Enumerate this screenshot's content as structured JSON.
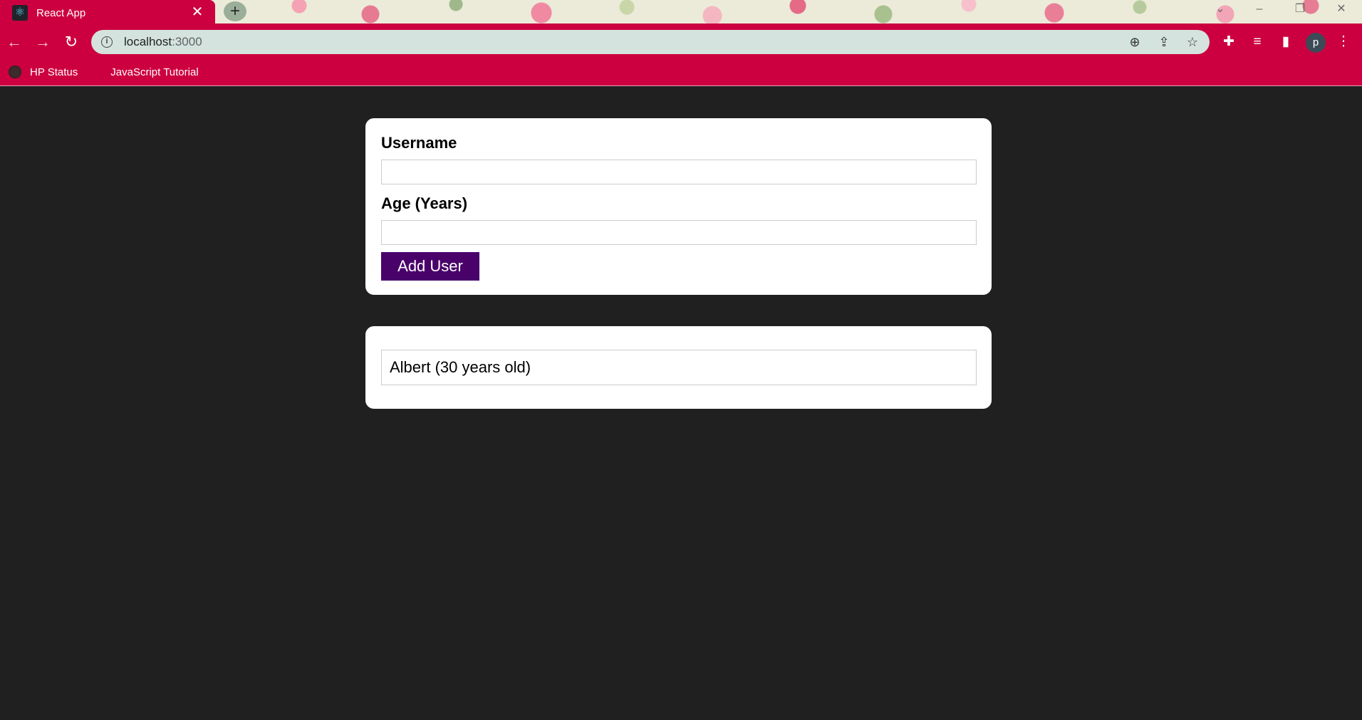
{
  "browser": {
    "tab_title": "React App",
    "tab_close": "✕",
    "new_tab": "+",
    "url_host": "localhost",
    "url_port": ":3000",
    "bookmarks": [
      {
        "label": "HP Status"
      },
      {
        "label": "JavaScript Tutorial"
      }
    ],
    "profile_initial": "p",
    "theme_color": "#cc0040",
    "omnibox_color": "#d4e3dd"
  },
  "form": {
    "username_label": "Username",
    "username_value": "",
    "age_label": "Age (Years)",
    "age_value": "",
    "submit_label": "Add User",
    "button_color": "#4a026b"
  },
  "users": [
    {
      "text": "Albert (30 years old)"
    }
  ],
  "page_background": "#202020"
}
